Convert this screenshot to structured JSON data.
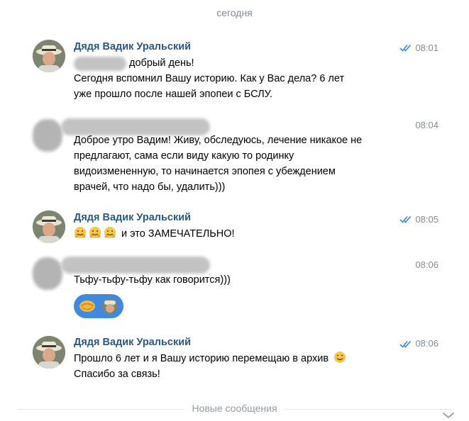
{
  "date_separator": "сегодня",
  "messages": [
    {
      "author": "Дядя Вадик Уральский",
      "time": "08:01",
      "lines": [
        "добрый день!",
        "Сегодня вспомнил Вашу историю. Как у Вас дела?  6 лет",
        "уже прошло после нашей эпопеи с БСЛУ."
      ]
    },
    {
      "author": "",
      "time": "08:04",
      "lines": [
        "Доброе утро Вадим! Живу, обследуюсь, лечение никакое не",
        "предлагают, сама если виду какую то родинку",
        "видоизмененную, то начинается эпопея с убеждением",
        "врачей, что надо бы, удалить)))"
      ]
    },
    {
      "author": "Дядя Вадик Уральский",
      "time": "08:05",
      "lines": [
        "и это ЗАМЕЧАТЕЛЬНО!"
      ]
    },
    {
      "author": "",
      "time": "08:06",
      "lines": [
        "Тьфу-тьфу-тьфу как говорится)))"
      ]
    },
    {
      "author": "Дядя Вадик Уральский",
      "time": "08:06",
      "lines": [
        "Прошло 6 лет и я Вашу историю перемещаю в архив",
        "Спасибо за связь!"
      ]
    }
  ],
  "new_messages_label": "Новые сообщения",
  "icons": {
    "read_checks": "double-check-icon",
    "smiling_face": "hugging-face-emoji-icon",
    "smile": "smiling-face-emoji-icon",
    "handshake": "handshake-emoji-icon",
    "scroll_down": "chevron-down-icon"
  },
  "colors": {
    "author": "#2a5885",
    "meta": "#818c99",
    "accent": "#3f8ae0"
  }
}
